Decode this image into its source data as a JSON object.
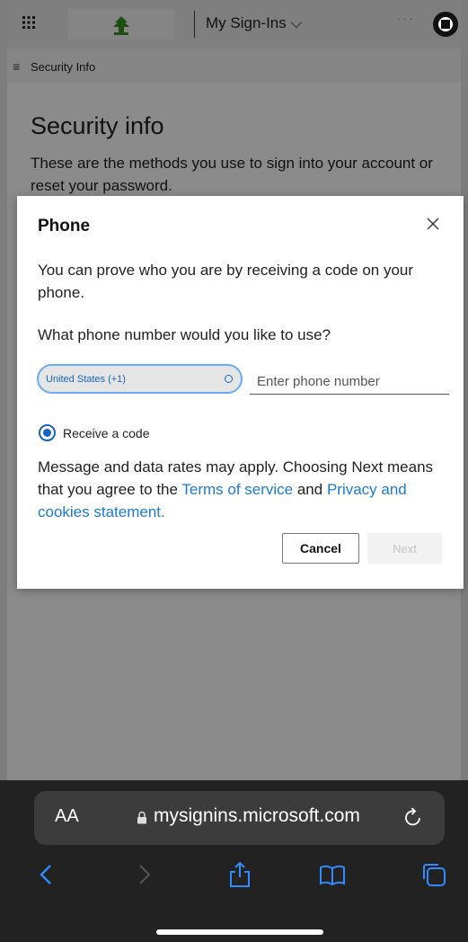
{
  "app": {
    "title": "My Sign-Ins ⌵",
    "menu_dots": "···"
  },
  "subnav": {
    "hamburger": "≡",
    "label": "Security Info"
  },
  "main": {
    "heading": "Security info",
    "description": "These are the methods you use to sign into your account or reset your password."
  },
  "dialog": {
    "title": "Phone",
    "description": "You can prove who you are by receiving a code on your phone.",
    "question": "What phone number would you like to use?",
    "country_selected": "United States (+1)",
    "phone_placeholder": "Enter phone number",
    "radio_label": "Receive a code",
    "note_prefix": "Message and data rates may apply. Choosing Next means that you agree to the ",
    "terms_link": "Terms of service",
    "note_and": " and ",
    "privacy_link": "Privacy and cookies statement.",
    "cancel_label": "Cancel",
    "next_label": "Next"
  },
  "browser": {
    "aa_label": "AA",
    "url": "mysignins.microsoft.com"
  },
  "colors": {
    "accent": "#1565c0",
    "link": "#1b7bd2",
    "overlay_bg": "#8b8b8b",
    "browser_bg": "#222222"
  },
  "icons": [
    "grid-icon",
    "tree-logo-icon",
    "avatar-icon",
    "close-icon",
    "select-arrow-icon",
    "lock-icon",
    "reload-icon",
    "back-icon",
    "forward-icon",
    "share-icon",
    "bookmarks-icon",
    "tabs-icon"
  ]
}
